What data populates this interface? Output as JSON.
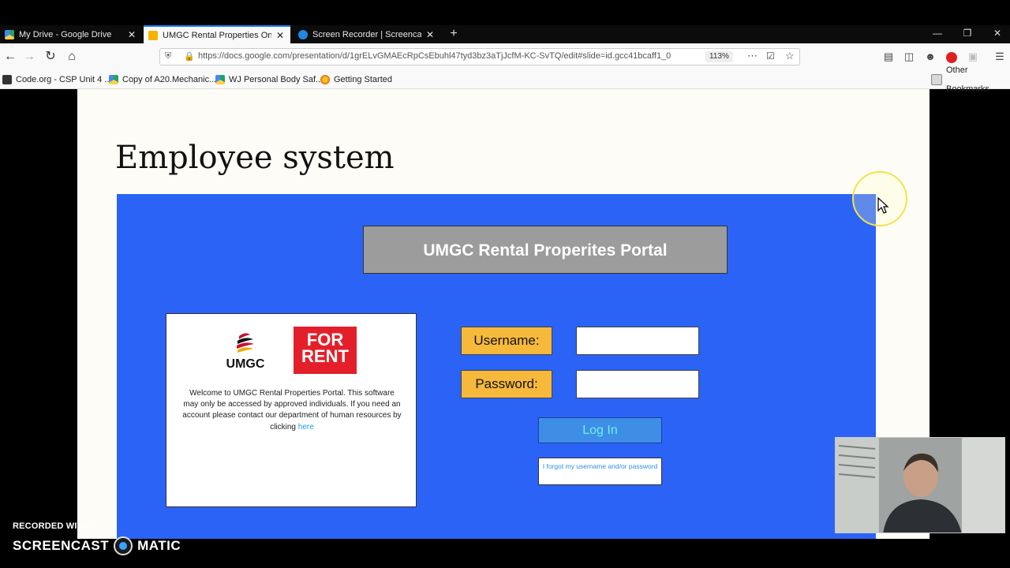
{
  "browser": {
    "tabs": [
      {
        "title": "My Drive - Google Drive",
        "close": "✕"
      },
      {
        "title": "UMGC Rental Properties Online",
        "close": "✕"
      },
      {
        "title": "Screen Recorder | Screencast-O",
        "close": "✕"
      }
    ],
    "new_tab": "+",
    "window_controls": {
      "minimize": "—",
      "restore": "❐",
      "close": "✕"
    },
    "url": "https://docs.google.com/presentation/d/1grELvGMAEcRpCsEbuhl47tyd3bz3aTjJcfM-KC-SvTQ/edit#slide=id.gcc41bcaff1_0",
    "zoom": "113%",
    "bookmarks": [
      {
        "label": "Code.org - CSP Unit 4 ..."
      },
      {
        "label": "Copy of A20.Mechanic..."
      },
      {
        "label": "WJ Personal Body Saf..."
      },
      {
        "label": "Getting Started"
      }
    ],
    "other_bookmarks": "Other Bookmarks"
  },
  "slide": {
    "title": "Employee system",
    "portal_title": "UMGC Rental Properites Portal",
    "logo_text": "UMGC",
    "rent_sign": {
      "line1": "FOR",
      "line2": "RENT"
    },
    "welcome_text": "Welcome to UMGC Rental Properties Portal. This software may only be accessed by approved individuals. If you need an account please contact our department of human resources by clicking",
    "welcome_link": "here",
    "username_label": "Username:",
    "password_label": "Password:",
    "login_label": "Log In",
    "forgot_label": "I forgot my username and/or password"
  },
  "watermark": {
    "recorded": "RECORDED WITH",
    "brand_left": "SCREENCAST",
    "brand_right": "MATIC"
  },
  "colors": {
    "panel": "#2b63f6",
    "header": "#9c9c9c",
    "label": "#f6b93b",
    "login": "#3e8ee8",
    "rent": "#e3202a"
  }
}
